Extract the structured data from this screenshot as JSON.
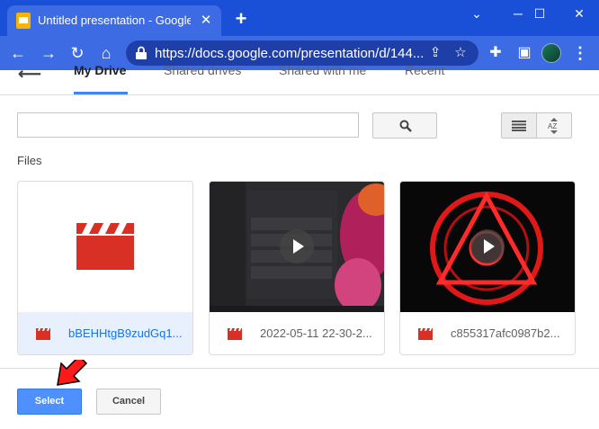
{
  "browser": {
    "tab_title": "Untitled presentation - Google Sl",
    "url": "https://docs.google.com/presentation/d/144..."
  },
  "picker": {
    "tabs": [
      {
        "label": "My Drive",
        "active": true
      },
      {
        "label": "Shared drives",
        "active": false
      },
      {
        "label": "Shared with me",
        "active": false
      },
      {
        "label": "Recent",
        "active": false
      }
    ],
    "search": {
      "value": "",
      "placeholder": ""
    },
    "section_label": "Files",
    "files": [
      {
        "name": "bBEHHtgB9zudGq1...",
        "selected": true,
        "thumbnail": "video-clapper-icon"
      },
      {
        "name": "2022-05-11 22-30-2...",
        "selected": false,
        "thumbnail": "settings-recovery-screenshot"
      },
      {
        "name": "c855317afc0987b2...",
        "selected": false,
        "thumbnail": "red-glowing-emblem"
      }
    ],
    "select_label": "Select",
    "cancel_label": "Cancel"
  },
  "colors": {
    "chrome_blue": "#1a4fd8",
    "accent_blue": "#4285f4",
    "select_button": "#4d90fe",
    "video_red": "#d93025"
  }
}
